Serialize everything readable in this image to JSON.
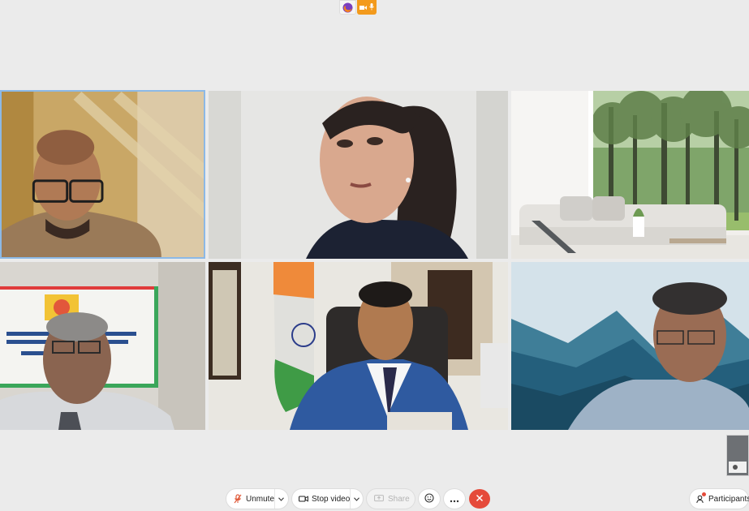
{
  "toolbar": {
    "unmute_label": "Unmute",
    "stop_video_label": "Stop video",
    "share_label": "Share",
    "participants_label": "Participants"
  },
  "colors": {
    "indicator_orange": "#f39a1c",
    "leave_red": "#e54a3a",
    "active_speaker_border": "#8cb9e6",
    "background": "#ebebeb"
  },
  "icons": {
    "browser_indicator": "firefox-icon",
    "camera_indicator": "camera-icon",
    "mic_indicator": "microphone-icon",
    "unmute": "muted-microphone-icon",
    "stop_video": "video-camera-icon",
    "share": "share-screen-icon",
    "reactions": "smiley-icon",
    "more": "more-options-icon",
    "leave": "close-icon",
    "participants": "participants-icon"
  }
}
